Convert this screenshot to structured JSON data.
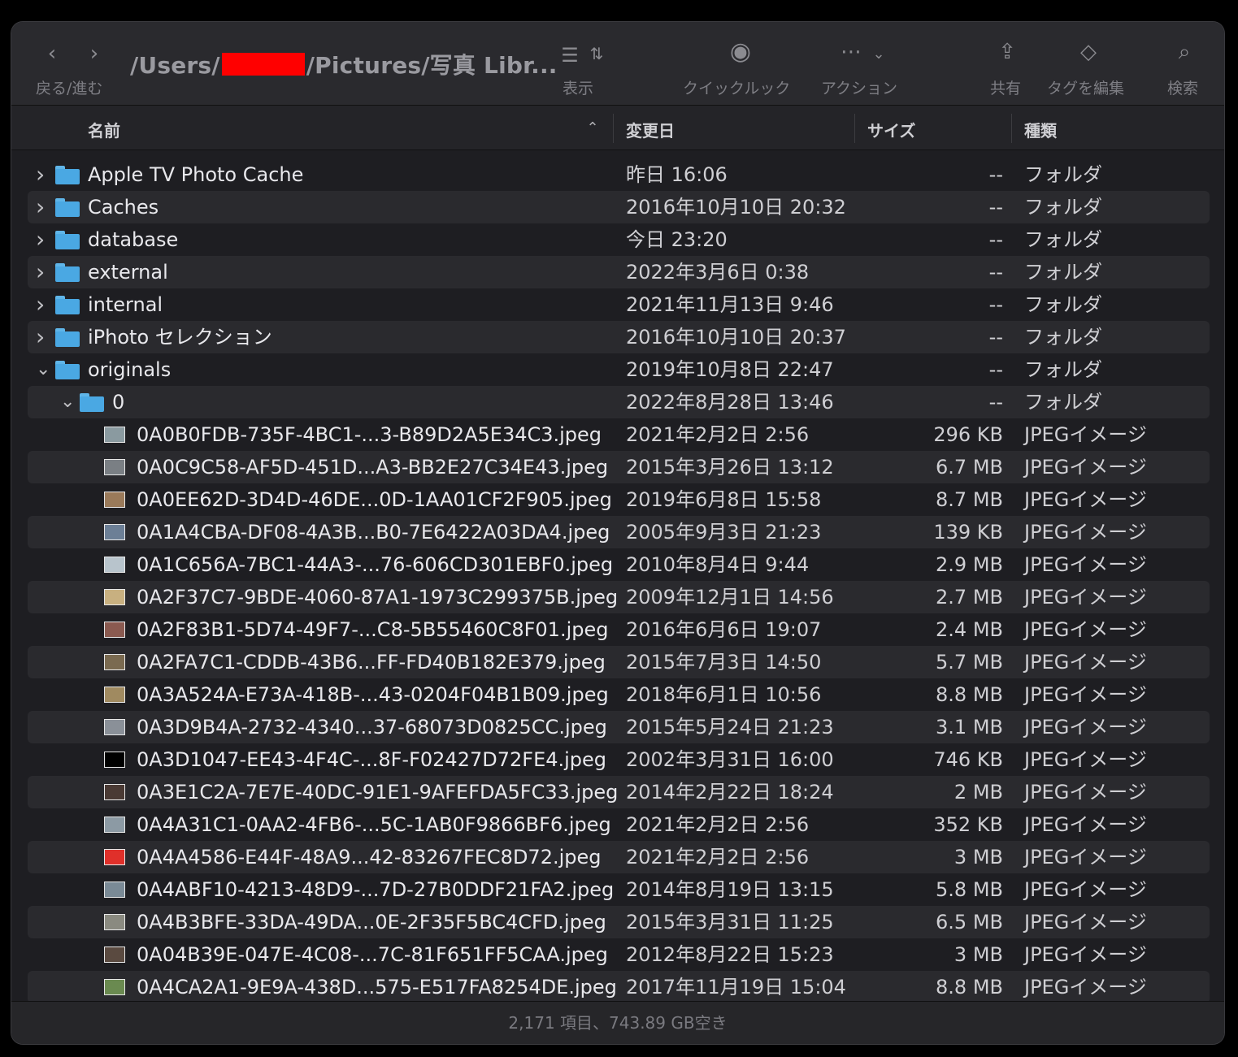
{
  "toolbar": {
    "nav_label": "戻る/進む",
    "path_prefix": "/Users/",
    "path_suffix": "/Pictures/写真 Libr...",
    "view_label": "表示",
    "quicklook_label": "クイックルック",
    "action_label": "アクション",
    "share_label": "共有",
    "tags_label": "タグを編集",
    "search_label": "検索"
  },
  "columns": {
    "name": "名前",
    "date": "変更日",
    "size": "サイズ",
    "kind": "種類"
  },
  "rows": [
    {
      "name": "Apple TV Photo Cache",
      "date": "昨日 16:06",
      "size": "--",
      "kind": "フォルダ",
      "type": "folder",
      "level": 0,
      "expanded": false
    },
    {
      "name": "Caches",
      "date": "2016年10月10日 20:32",
      "size": "--",
      "kind": "フォルダ",
      "type": "folder",
      "level": 0,
      "expanded": false
    },
    {
      "name": "database",
      "date": "今日 23:20",
      "size": "--",
      "kind": "フォルダ",
      "type": "folder",
      "level": 0,
      "expanded": false
    },
    {
      "name": "external",
      "date": "2022年3月6日 0:38",
      "size": "--",
      "kind": "フォルダ",
      "type": "folder",
      "level": 0,
      "expanded": false
    },
    {
      "name": "internal",
      "date": "2021年11月13日 9:46",
      "size": "--",
      "kind": "フォルダ",
      "type": "folder",
      "level": 0,
      "expanded": false
    },
    {
      "name": "iPhoto セレクション",
      "date": "2016年10月10日 20:37",
      "size": "--",
      "kind": "フォルダ",
      "type": "folder",
      "level": 0,
      "expanded": false
    },
    {
      "name": "originals",
      "date": "2019年10月8日 22:47",
      "size": "--",
      "kind": "フォルダ",
      "type": "folder",
      "level": 0,
      "expanded": true
    },
    {
      "name": "0",
      "date": "2022年8月28日 13:46",
      "size": "--",
      "kind": "フォルダ",
      "type": "folder",
      "level": 1,
      "expanded": true
    },
    {
      "name": "0A0B0FDB-735F-4BC1-...3-B89D2A5E34C3.jpeg",
      "date": "2021年2月2日 2:56",
      "size": "296 KB",
      "kind": "JPEGイメージ",
      "type": "file",
      "level": 2,
      "thumb": "#8a9aa0"
    },
    {
      "name": "0A0C9C58-AF5D-451D...A3-BB2E27C34E43.jpeg",
      "date": "2015年3月26日 13:12",
      "size": "6.7 MB",
      "kind": "JPEGイメージ",
      "type": "file",
      "level": 2,
      "thumb": "#7a7f84"
    },
    {
      "name": "0A0EE62D-3D4D-46DE...0D-1AA01CF2F905.jpeg",
      "date": "2019年6月8日 15:58",
      "size": "8.7 MB",
      "kind": "JPEGイメージ",
      "type": "file",
      "level": 2,
      "thumb": "#9a7a5a"
    },
    {
      "name": "0A1A4CBA-DF08-4A3B...B0-7E6422A03DA4.jpeg",
      "date": "2005年9月3日 21:23",
      "size": "139 KB",
      "kind": "JPEGイメージ",
      "type": "file",
      "level": 2,
      "thumb": "#6c7f96"
    },
    {
      "name": "0A1C656A-7BC1-44A3-...76-606CD301EBF0.jpeg",
      "date": "2010年8月4日 9:44",
      "size": "2.9 MB",
      "kind": "JPEGイメージ",
      "type": "file",
      "level": 2,
      "thumb": "#b8c4cc"
    },
    {
      "name": "0A2F37C7-9BDE-4060-87A1-1973C299375B.jpeg",
      "date": "2009年12月1日 14:56",
      "size": "2.7 MB",
      "kind": "JPEGイメージ",
      "type": "file",
      "level": 2,
      "thumb": "#c8b080"
    },
    {
      "name": "0A2F83B1-5D74-49F7-...C8-5B55460C8F01.jpeg",
      "date": "2016年6月6日 19:07",
      "size": "2.4 MB",
      "kind": "JPEGイメージ",
      "type": "file",
      "level": 2,
      "thumb": "#8a5a50"
    },
    {
      "name": "0A2FA7C1-CDDB-43B6...FF-FD40B182E379.jpeg",
      "date": "2015年7月3日 14:50",
      "size": "5.7 MB",
      "kind": "JPEGイメージ",
      "type": "file",
      "level": 2,
      "thumb": "#7a6a50"
    },
    {
      "name": "0A3A524A-E73A-418B-...43-0204F04B1B09.jpeg",
      "date": "2018年6月1日 10:56",
      "size": "8.8 MB",
      "kind": "JPEGイメージ",
      "type": "file",
      "level": 2,
      "thumb": "#a08a60"
    },
    {
      "name": "0A3D9B4A-2732-4340...37-68073D0825CC.jpeg",
      "date": "2015年5月24日 21:23",
      "size": "3.1 MB",
      "kind": "JPEGイメージ",
      "type": "file",
      "level": 2,
      "thumb": "#8a9098"
    },
    {
      "name": "0A3D1047-EE43-4F4C-...8F-F02427D72FE4.jpeg",
      "date": "2002年3月31日 16:00",
      "size": "746 KB",
      "kind": "JPEGイメージ",
      "type": "file",
      "level": 2,
      "thumb": "#000000"
    },
    {
      "name": "0A3E1C2A-7E7E-40DC-91E1-9AFEFDA5FC33.jpeg",
      "date": "2014年2月22日 18:24",
      "size": "2 MB",
      "kind": "JPEGイメージ",
      "type": "file",
      "level": 2,
      "thumb": "#4a3a34"
    },
    {
      "name": "0A4A31C1-0AA2-4FB6-...5C-1AB0F9866BF6.jpeg",
      "date": "2021年2月2日 2:56",
      "size": "352 KB",
      "kind": "JPEGイメージ",
      "type": "file",
      "level": 2,
      "thumb": "#8c9aa4"
    },
    {
      "name": "0A4A4586-E44F-48A9...42-83267FEC8D72.jpeg",
      "date": "2021年2月2日 2:56",
      "size": "3 MB",
      "kind": "JPEGイメージ",
      "type": "file",
      "level": 2,
      "thumb": "#e0302a"
    },
    {
      "name": "0A4ABF10-4213-48D9-...7D-27B0DDF21FA2.jpeg",
      "date": "2014年8月19日 13:15",
      "size": "5.8 MB",
      "kind": "JPEGイメージ",
      "type": "file",
      "level": 2,
      "thumb": "#7a8a96"
    },
    {
      "name": "0A4B3BFE-33DA-49DA...0E-2F35F5BC4CFD.jpeg",
      "date": "2015年3月31日 11:25",
      "size": "6.5 MB",
      "kind": "JPEGイメージ",
      "type": "file",
      "level": 2,
      "thumb": "#8a8a80"
    },
    {
      "name": "0A04B39E-047E-4C08-...7C-81F651FF5CAA.jpeg",
      "date": "2012年8月22日 15:23",
      "size": "3 MB",
      "kind": "JPEGイメージ",
      "type": "file",
      "level": 2,
      "thumb": "#5a4a40"
    },
    {
      "name": "0A4CA2A1-9E9A-438D...575-E517FA8254DE.jpeg",
      "date": "2017年11月19日 15:04",
      "size": "8.8 MB",
      "kind": "JPEGイメージ",
      "type": "file",
      "level": 2,
      "thumb": "#6a8a50"
    }
  ],
  "status": "2,171 項目、743.89 GB空き",
  "colors": {
    "folder": "#4aa8e3",
    "redaction": "#ff0000"
  }
}
